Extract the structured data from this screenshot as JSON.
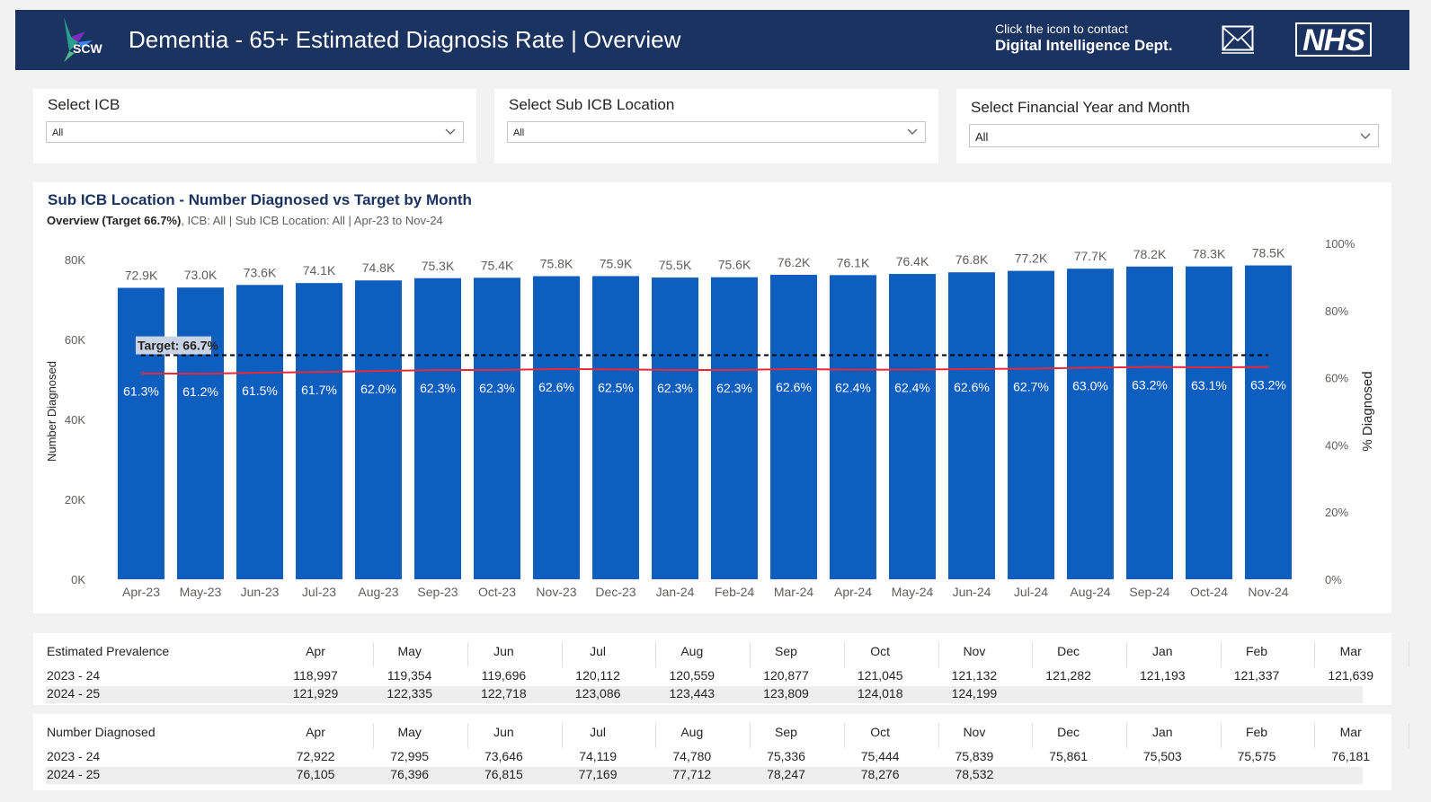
{
  "header": {
    "logo_text": "SCW",
    "title": "Dementia - 65+ Estimated Diagnosis Rate | Overview",
    "contact_line1": "Click the icon to contact",
    "contact_line2": "Digital Intelligence Dept.",
    "nhs_logo": "NHS",
    "mail_icon": "envelope-icon"
  },
  "slicers": {
    "icb": {
      "label": "Select ICB",
      "value": "All"
    },
    "sub_icb": {
      "label": "Select Sub ICB Location",
      "value": "All"
    },
    "fy_month": {
      "label": "Select Financial Year and Month",
      "value": "All"
    }
  },
  "chart_data": {
    "type": "bar",
    "title": "Sub ICB Location - Number Diagnosed vs Target by Month",
    "subtitle_bold": "Overview (Target 66.7%)",
    "subtitle_rest": ", ICB: All | Sub ICB Location: All | Apr-23 to Nov-24",
    "ylabel": "Number Diagnosed",
    "y2label": "% Diagnosed",
    "ylim": [
      0,
      80000
    ],
    "y2lim": [
      0,
      100
    ],
    "y_ticks": [
      "0K",
      "20K",
      "40K",
      "60K",
      "80K"
    ],
    "y2_ticks": [
      "0%",
      "20%",
      "40%",
      "60%",
      "80%",
      "100%"
    ],
    "target_label": "Target: 66.7%",
    "target": 66.7,
    "categories": [
      "Apr-23",
      "May-23",
      "Jun-23",
      "Jul-23",
      "Aug-23",
      "Sep-23",
      "Oct-23",
      "Nov-23",
      "Dec-23",
      "Jan-24",
      "Feb-24",
      "Mar-24",
      "Apr-24",
      "May-24",
      "Jun-24",
      "Jul-24",
      "Aug-24",
      "Sep-24",
      "Oct-24",
      "Nov-24"
    ],
    "series": [
      {
        "name": "Number Diagnosed",
        "values": [
          72922,
          72995,
          73646,
          74119,
          74780,
          75336,
          75444,
          75839,
          75861,
          75503,
          75575,
          76181,
          76105,
          76396,
          76815,
          77169,
          77712,
          78247,
          78276,
          78532
        ],
        "labels": [
          "72.9K",
          "73.0K",
          "73.6K",
          "74.1K",
          "74.8K",
          "75.3K",
          "75.4K",
          "75.8K",
          "75.9K",
          "75.5K",
          "75.6K",
          "76.2K",
          "76.1K",
          "76.4K",
          "76.8K",
          "77.2K",
          "77.7K",
          "78.2K",
          "78.3K",
          "78.5K"
        ]
      },
      {
        "name": "% Diagnosed",
        "values": [
          61.3,
          61.2,
          61.5,
          61.7,
          62.0,
          62.3,
          62.3,
          62.6,
          62.5,
          62.3,
          62.3,
          62.6,
          62.4,
          62.4,
          62.6,
          62.7,
          63.0,
          63.2,
          63.1,
          63.2
        ],
        "labels": [
          "61.3%",
          "61.2%",
          "61.5%",
          "61.7%",
          "62.0%",
          "62.3%",
          "62.3%",
          "62.6%",
          "62.5%",
          "62.3%",
          "62.3%",
          "62.6%",
          "62.4%",
          "62.4%",
          "62.6%",
          "62.7%",
          "63.0%",
          "63.2%",
          "63.1%",
          "63.2%"
        ]
      }
    ],
    "colors": {
      "bar": "#0e5ec0",
      "line": "#e8283a",
      "target": "#000000"
    }
  },
  "tables": [
    {
      "title": "Estimated Prevalence",
      "months": [
        "Apr",
        "May",
        "Jun",
        "Jul",
        "Aug",
        "Sep",
        "Oct",
        "Nov",
        "Dec",
        "Jan",
        "Feb",
        "Mar"
      ],
      "rows": [
        {
          "label": "2023 - 24",
          "values": [
            "118,997",
            "119,354",
            "119,696",
            "120,112",
            "120,559",
            "120,877",
            "121,045",
            "121,132",
            "121,282",
            "121,193",
            "121,337",
            "121,639"
          ]
        },
        {
          "label": "2024 - 25",
          "values": [
            "121,929",
            "122,335",
            "122,718",
            "123,086",
            "123,443",
            "123,809",
            "124,018",
            "124,199",
            "",
            "",
            "",
            ""
          ]
        }
      ]
    },
    {
      "title": "Number Diagnosed",
      "months": [
        "Apr",
        "May",
        "Jun",
        "Jul",
        "Aug",
        "Sep",
        "Oct",
        "Nov",
        "Dec",
        "Jan",
        "Feb",
        "Mar"
      ],
      "rows": [
        {
          "label": "2023 - 24",
          "values": [
            "72,922",
            "72,995",
            "73,646",
            "74,119",
            "74,780",
            "75,336",
            "75,444",
            "75,839",
            "75,861",
            "75,503",
            "75,575",
            "76,181"
          ]
        },
        {
          "label": "2024 - 25",
          "values": [
            "76,105",
            "76,396",
            "76,815",
            "77,169",
            "77,712",
            "78,247",
            "78,276",
            "78,532",
            "",
            "",
            "",
            ""
          ]
        }
      ]
    }
  ]
}
